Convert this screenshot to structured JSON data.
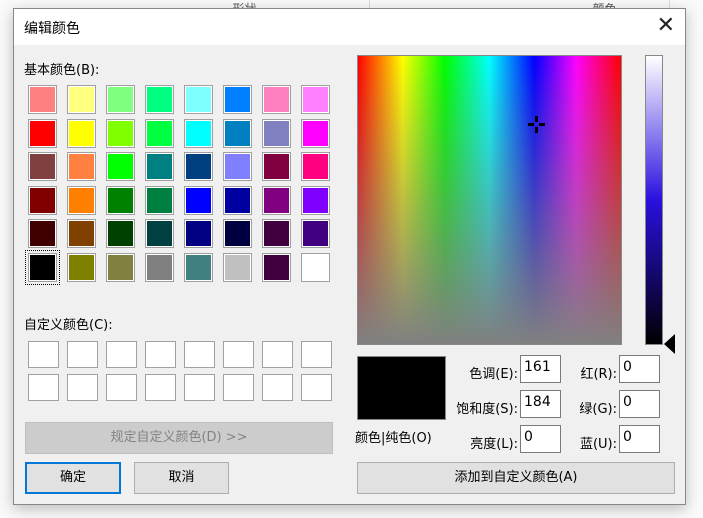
{
  "background": {
    "col1": "形状",
    "col2": "颜色"
  },
  "dialog": {
    "title": "编辑颜色",
    "close_icon": "close-icon"
  },
  "basic_colors": {
    "label": "基本颜色(B):",
    "colors": [
      [
        "#FF8080",
        "#FFFF80",
        "#80FF80",
        "#00FF80",
        "#80FFFF",
        "#0080FF",
        "#FF80C0",
        "#FF80FF"
      ],
      [
        "#FF0000",
        "#FFFF00",
        "#80FF00",
        "#00FF40",
        "#00FFFF",
        "#0080C0",
        "#8080C0",
        "#FF00FF"
      ],
      [
        "#804040",
        "#FF8040",
        "#00FF00",
        "#008080",
        "#004080",
        "#8080FF",
        "#800040",
        "#FF0080"
      ],
      [
        "#800000",
        "#FF8000",
        "#008000",
        "#008040",
        "#0000FF",
        "#0000A0",
        "#800080",
        "#8000FF"
      ],
      [
        "#400000",
        "#804000",
        "#004000",
        "#004040",
        "#000080",
        "#000040",
        "#400040",
        "#400080"
      ],
      [
        "#000000",
        "#808000",
        "#808040",
        "#808080",
        "#408080",
        "#C0C0C0",
        "#400040",
        "#FFFFFF"
      ]
    ],
    "selected": "#000000"
  },
  "custom_colors": {
    "label": "自定义颜色(C):"
  },
  "buttons": {
    "define": "规定自定义颜色(D) >>",
    "ok": "确定",
    "cancel": "取消",
    "add": "添加到自定义颜色(A)"
  },
  "preview": {
    "label": "颜色|纯色(O)",
    "color": "#000000"
  },
  "fields": {
    "hue_label": "色调(E):",
    "hue": "161",
    "sat_label": "饱和度(S):",
    "sat": "184",
    "lum_label": "亮度(L):",
    "lum": "0",
    "red_label": "红(R):",
    "red": "0",
    "green_label": "绿(G):",
    "green": "0",
    "blue_label": "蓝(U):",
    "blue": "0"
  }
}
